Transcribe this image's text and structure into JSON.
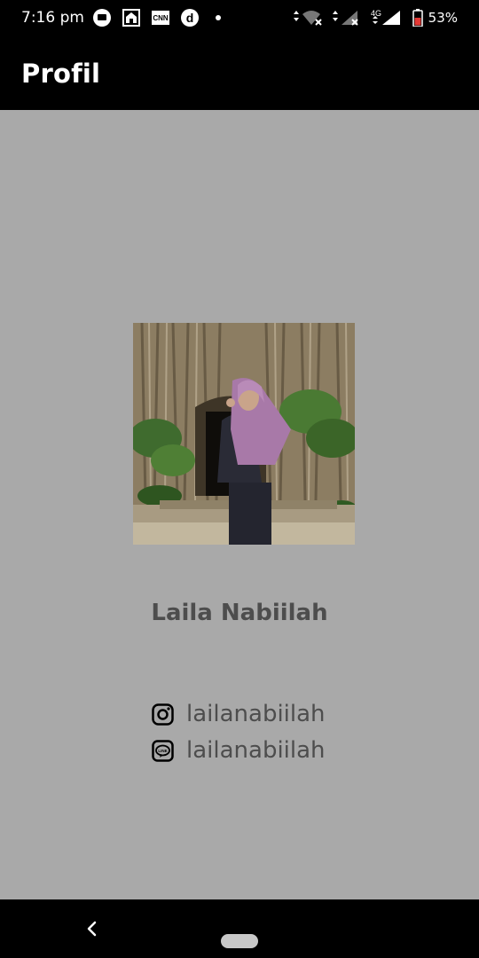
{
  "status_bar": {
    "time": "7:16 pm",
    "network": "4G",
    "battery_percent": "53%"
  },
  "app_bar": {
    "title": "Profil"
  },
  "profile": {
    "photo_icon": "profile-photo",
    "name": "Laila Nabiilah",
    "contacts": [
      {
        "icon": "instagram-icon",
        "handle": "lailanabiilah"
      },
      {
        "icon": "line-icon",
        "handle": "lailanabiilah"
      }
    ]
  },
  "colors": {
    "background": "#a9a9a9",
    "bars": "#000000",
    "text": "#4d4d4d"
  }
}
